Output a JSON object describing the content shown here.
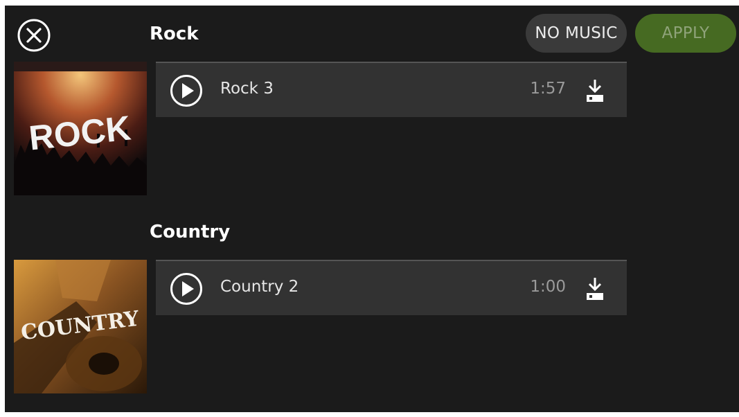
{
  "header": {
    "close_icon": "close-circle-icon",
    "no_music_label": "NO MUSIC",
    "apply_label": "APPLY"
  },
  "colors": {
    "background": "#1b1b1b",
    "row_background": "#323232",
    "no_music_bg": "#3a3a3a",
    "apply_bg": "#466a22",
    "apply_text": "#8fa37a"
  },
  "sections": [
    {
      "title": "Rock",
      "thumbnail_text": "ROCK",
      "tracks": [
        {
          "name": "Rock 3",
          "duration": "1:57",
          "play_icon": "play-circle-icon",
          "download_icon": "download-icon"
        }
      ]
    },
    {
      "title": "Country",
      "thumbnail_text": "COUNTRY",
      "tracks": [
        {
          "name": "Country 2",
          "duration": "1:00",
          "play_icon": "play-circle-icon",
          "download_icon": "download-icon"
        }
      ]
    }
  ]
}
